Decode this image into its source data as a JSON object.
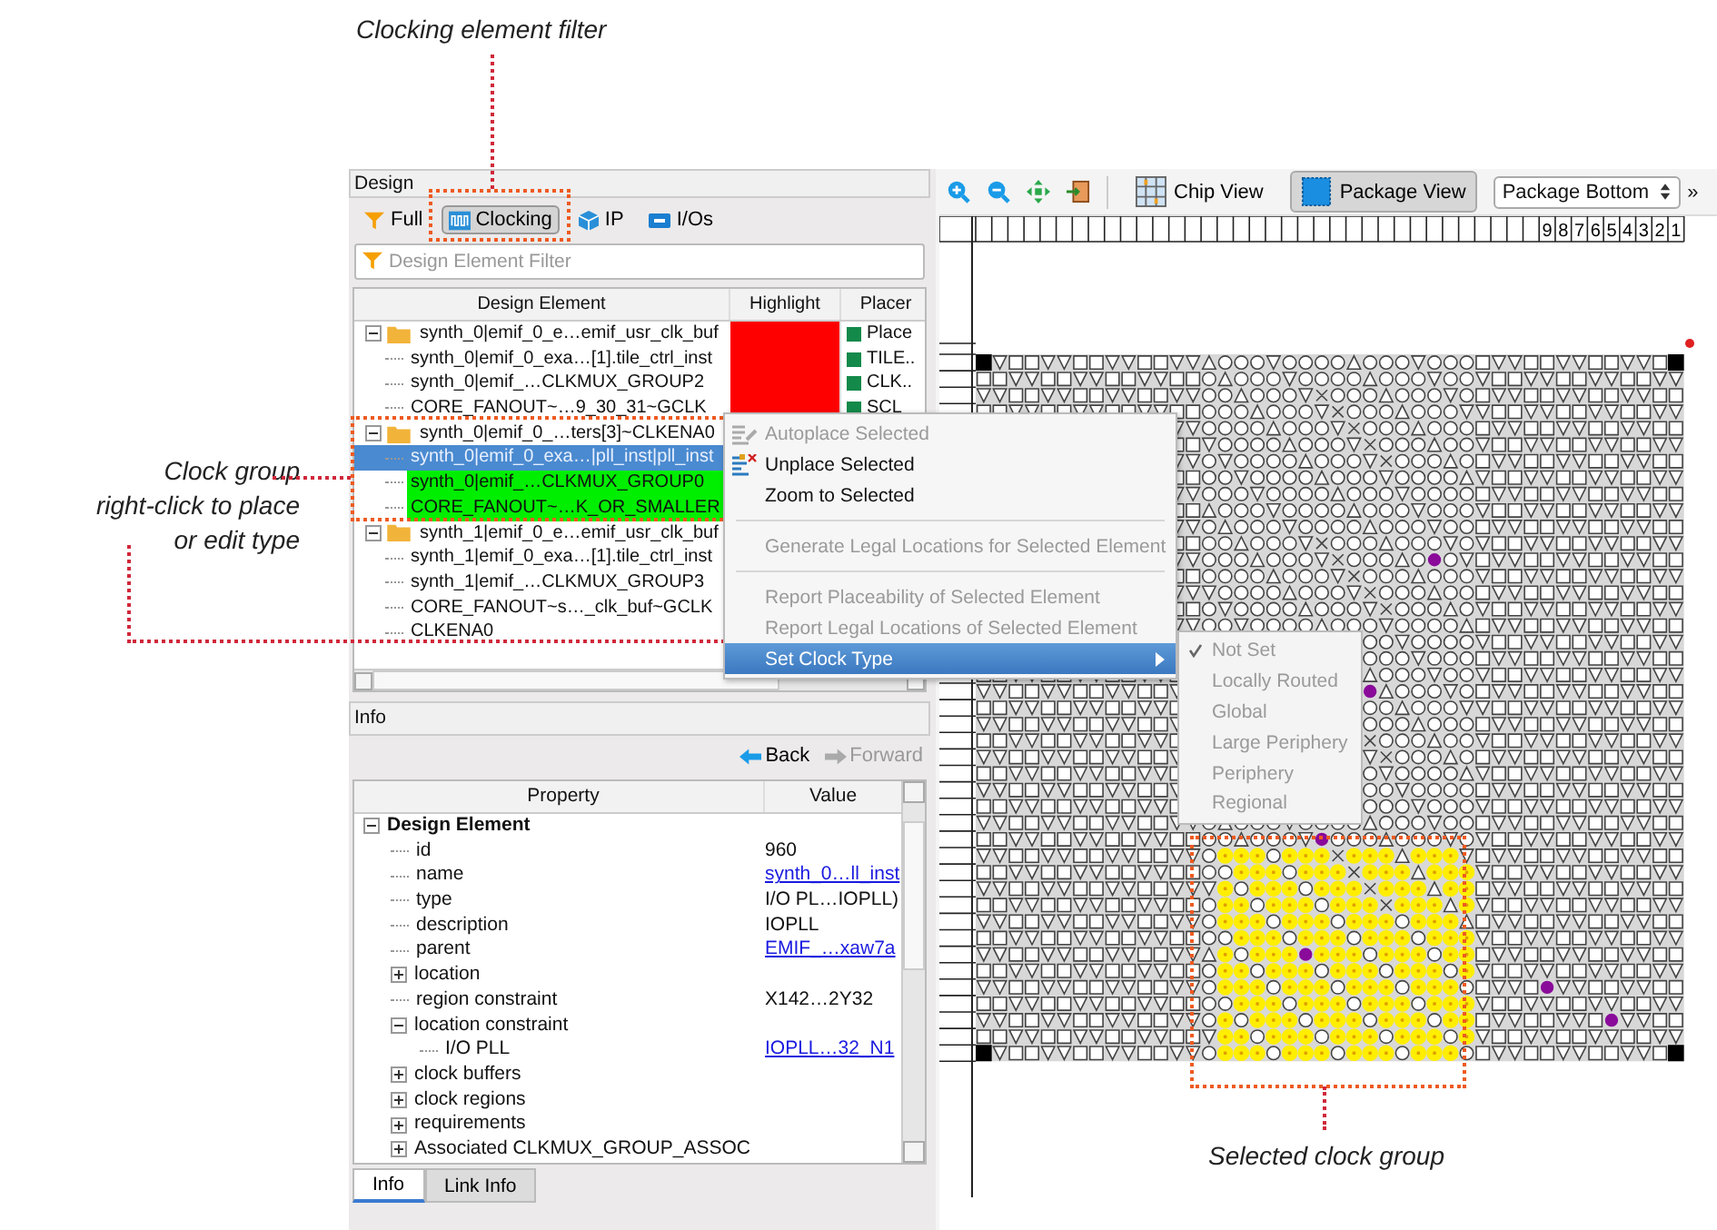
{
  "annotations": [
    {
      "kind": "top",
      "text": "Clocking element filter"
    },
    {
      "kind": "left",
      "lines": [
        "Clock group",
        "right-click to place",
        "or edit type"
      ]
    },
    {
      "kind": "bottom",
      "text": "Selected clock group"
    }
  ],
  "design_panel": {
    "title": "Design",
    "filters": [
      {
        "label": "Full",
        "kind": "funnel",
        "selected": false
      },
      {
        "label": "Clocking",
        "kind": "clock",
        "selected": true
      },
      {
        "label": "IP",
        "kind": "cube",
        "selected": false
      },
      {
        "label": "I/Os",
        "kind": "io",
        "selected": false
      }
    ],
    "filter_field": {
      "placeholder": "Design Element Filter"
    },
    "tree": {
      "columns": [
        "Design Element",
        "Highlight",
        "Placer"
      ],
      "groups": [
        {
          "name": "synth_0|emif_0_e…emif_usr_clk_buf",
          "expanded": true,
          "selected": false,
          "color": "#ff0000",
          "placer": "Place",
          "children": [
            {
              "name": "synth_0|emif_0_exa…[1].tile_ctrl_inst",
              "selected": false,
              "highlighted": false,
              "color": "#ff0000",
              "placer": "TILE.."
            },
            {
              "name": "synth_0|emif_…CLKMUX_GROUP2",
              "selected": false,
              "highlighted": false,
              "color": "#ff0000",
              "placer": "CLK.."
            },
            {
              "name": "CORE_FANOUT~…9_30_31~GCLK",
              "selected": false,
              "highlighted": false,
              "color": "#ff0000",
              "placer": "SCL"
            }
          ]
        },
        {
          "name": "synth_0|emif_0_…ters[3]~CLKENA0",
          "expanded": true,
          "selected": false,
          "children": [
            {
              "name": "synth_0|emif_0_exa…|pll_inst|pll_inst",
              "selected": true,
              "highlighted": false
            },
            {
              "name": "synth_0|emif_…CLKMUX_GROUP0",
              "selected": false,
              "highlighted": true,
              "color": "#00ee00"
            },
            {
              "name": "CORE_FANOUT~…K_OR_SMALLER",
              "selected": false,
              "highlighted": true,
              "color": "#00ee00"
            }
          ]
        },
        {
          "name": "synth_1|emif_0_e…emif_usr_clk_buf",
          "expanded": true,
          "selected": false,
          "children": [
            {
              "name": "synth_1|emif_0_exa…[1].tile_ctrl_inst",
              "selected": false,
              "highlighted": false
            },
            {
              "name": "synth_1|emif_…CLKMUX_GROUP3",
              "selected": false,
              "highlighted": false
            },
            {
              "name": "CORE_FANOUT~s…_clk_buf~GCLK",
              "selected": false,
              "highlighted": false
            },
            {
              "name": "CLKENA0",
              "selected": false,
              "highlighted": false
            }
          ]
        }
      ]
    }
  },
  "info_panel": {
    "title": "Info",
    "back": "Back",
    "forward": "Forward",
    "forward_disabled": true,
    "columns": [
      "Property",
      "Value"
    ],
    "rows": [
      {
        "property": "Design Element",
        "expanded": true,
        "children": [
          {
            "property": "id",
            "value": "960",
            "link": false
          },
          {
            "property": "name",
            "value": "synth_0…ll_inst",
            "link": true
          },
          {
            "property": "type",
            "value": "I/O PL…IOPLL)",
            "link": false
          },
          {
            "property": "description",
            "value": "IOPLL",
            "link": false
          },
          {
            "property": "parent",
            "value": "EMIF_…xaw7a",
            "link": true
          },
          {
            "property": "location",
            "expanded": false
          },
          {
            "property": "region constraint",
            "value": "X142…2Y32",
            "link": false
          },
          {
            "property": "location constraint",
            "expanded": true,
            "children": [
              {
                "property": "I/O PLL",
                "value": "IOPLL…32_N1",
                "link": true
              }
            ]
          },
          {
            "property": "clock buffers",
            "expanded": false
          },
          {
            "property": "clock regions",
            "expanded": false
          },
          {
            "property": "requirements",
            "expanded": false
          },
          {
            "property": "Associated CLKMUX_GROUP_ASSOC",
            "expanded": false
          }
        ]
      }
    ],
    "tabs": [
      {
        "label": "Info",
        "selected": true
      },
      {
        "label": "Link Info",
        "selected": false
      }
    ]
  },
  "view_toolbar": {
    "views": [
      {
        "label": "Chip View",
        "kind": "chip",
        "selected": false
      },
      {
        "label": "Package View",
        "kind": "package",
        "selected": true
      }
    ],
    "view_select": {
      "value": "Package Bottom"
    },
    "overflow": "»"
  },
  "package_view": {
    "ruler_labels": [
      "9",
      "8",
      "7",
      "6",
      "5",
      "4",
      "3",
      "2",
      "1"
    ]
  },
  "context_menu": {
    "sections": [
      [
        {
          "label": "Autoplace Selected",
          "kind": "autoplace",
          "disabled": true,
          "selected": false
        },
        {
          "label": "Unplace Selected",
          "kind": "unplace",
          "disabled": false,
          "selected": false
        },
        {
          "label": "Zoom to Selected",
          "kind": "plain",
          "disabled": false,
          "selected": false
        }
      ],
      [
        {
          "label": "Generate Legal Locations for Selected Element",
          "kind": "plain",
          "disabled": true,
          "selected": false
        }
      ],
      [
        {
          "label": "Report Placeability of Selected Element",
          "kind": "plain",
          "disabled": true,
          "selected": false
        },
        {
          "label": "Report Legal Locations of Selected Element",
          "kind": "plain",
          "disabled": true,
          "selected": false
        },
        {
          "label": "Set Clock Type",
          "kind": "submenu",
          "disabled": false,
          "selected": true
        }
      ]
    ]
  },
  "submenu": {
    "items": [
      {
        "label": "Not Set",
        "checked": true,
        "disabled": true
      },
      {
        "label": "Locally Routed",
        "checked": false,
        "disabled": true
      },
      {
        "label": "Global",
        "checked": false,
        "disabled": true
      },
      {
        "label": "Large Periphery",
        "checked": false,
        "disabled": true
      },
      {
        "label": "Periphery",
        "checked": false,
        "disabled": true
      },
      {
        "label": "Regional",
        "checked": false,
        "disabled": true
      }
    ]
  }
}
